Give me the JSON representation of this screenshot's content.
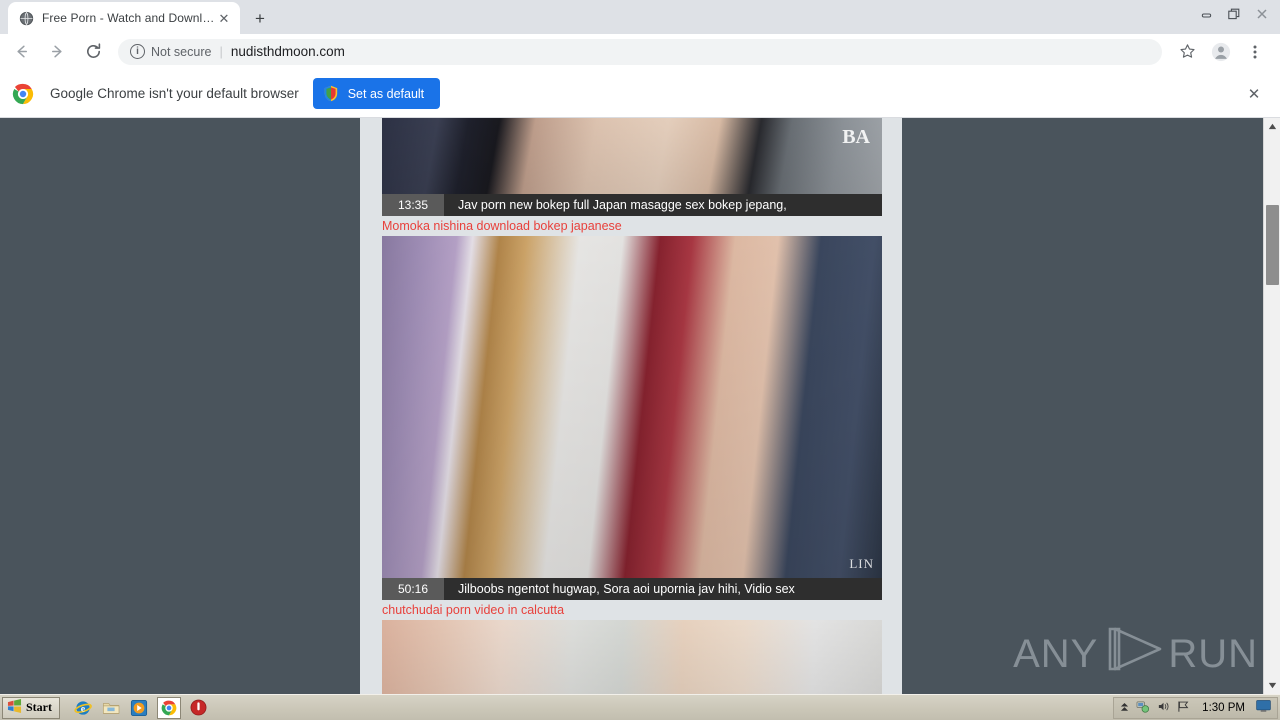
{
  "window": {
    "controls": [
      {
        "name": "minimize-button",
        "glyph": "—"
      },
      {
        "name": "restore-button",
        "glyph": "❐"
      },
      {
        "name": "close-button",
        "glyph": "✕"
      }
    ]
  },
  "tabstrip": {
    "tab": {
      "title": "Free Porn - Watch and Download",
      "favicon": "globe-icon",
      "close_glyph": "✕"
    },
    "new_tab_glyph": "+"
  },
  "toolbar": {
    "back_glyph": "←",
    "forward_glyph": "→",
    "reload_glyph": "⟳",
    "security_label": "Not secure",
    "security_icon": "info-circle-icon",
    "separator": "|",
    "url": "nudisthdmoon.com",
    "bookmark_glyph": "☆",
    "profile_icon": "avatar-icon",
    "menu_glyph": "⋮"
  },
  "infobar": {
    "message": "Google Chrome isn't your default browser",
    "button_label": "Set as default",
    "button_color": "#1a73e8",
    "close_glyph": "✕"
  },
  "page": {
    "videos": [
      {
        "duration": "13:35",
        "caption": "Jav porn new bokep full Japan masagge sex bokep jepang,",
        "overflow": "Momoka nishina download bokep japanese",
        "thumb_class": "th-a",
        "badge": "BA",
        "corner": ""
      },
      {
        "duration": "50:16",
        "caption": "Jilboobs ngentot hugwap, Sora aoi upornia jav hihi, Vidio sex",
        "overflow": "chutchudai porn video in calcutta",
        "thumb_class": "th-b",
        "badge": "",
        "corner": "LIN"
      },
      {
        "duration": "",
        "caption": "",
        "overflow": "",
        "thumb_class": "th-c",
        "badge": "",
        "corner": ""
      }
    ],
    "link_color": "#e8413c",
    "background": "#dfe3e6"
  },
  "watermark": {
    "part1": "ANY",
    "part2": "RUN",
    "logo": "play-triangle-icon"
  },
  "scrollbar": {
    "up_glyph": "▲",
    "down_glyph": "▼"
  },
  "taskbar": {
    "start_label": "Start",
    "quicklaunch": [
      {
        "name": "internet-explorer-icon"
      },
      {
        "name": "folder-icon"
      },
      {
        "name": "media-player-icon"
      },
      {
        "name": "chrome-icon"
      },
      {
        "name": "stop-icon"
      }
    ],
    "tray": {
      "icons": [
        {
          "name": "chevron-up-icon",
          "glyph": "⌃"
        },
        {
          "name": "network-icon"
        },
        {
          "name": "volume-icon"
        },
        {
          "name": "flag-icon"
        }
      ],
      "clock": "1:30 PM",
      "desktop_icon": "show-desktop-icon"
    }
  }
}
